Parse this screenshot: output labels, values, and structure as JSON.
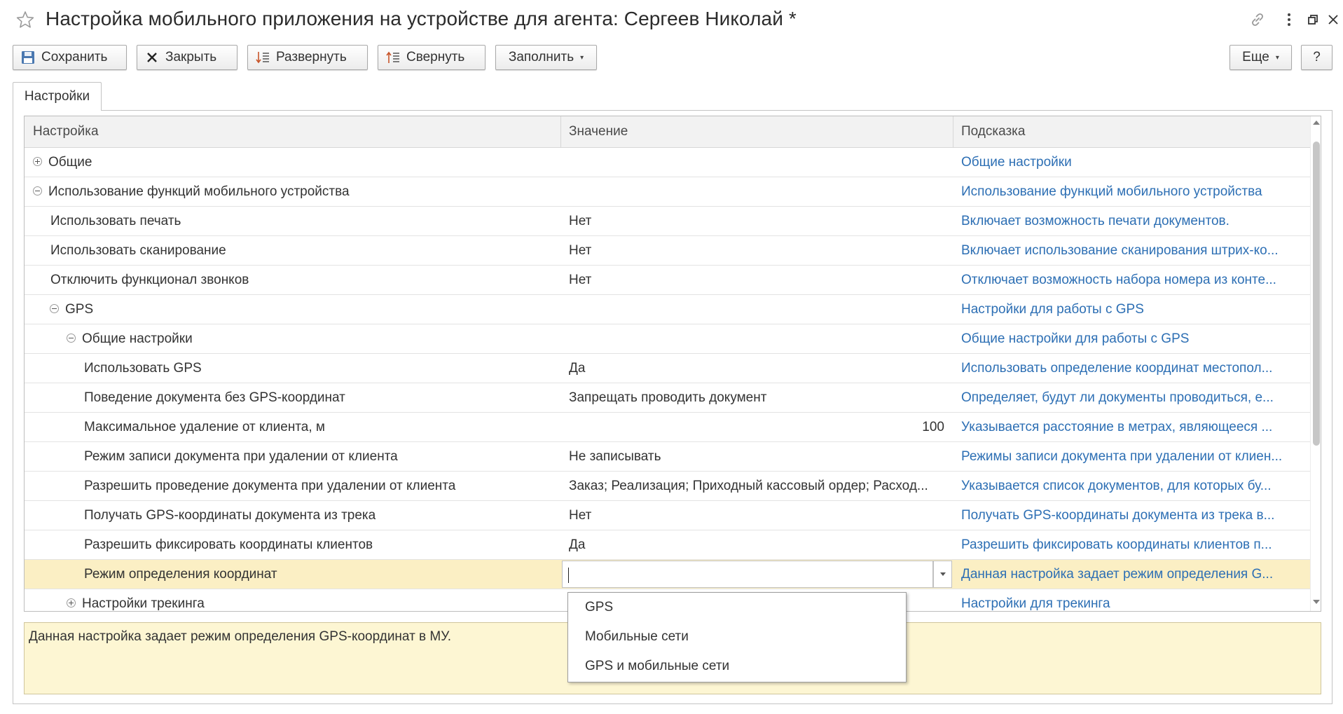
{
  "window": {
    "title": "Настройка мобильного приложения на устройстве для агента: Сергеев Николай *"
  },
  "toolbar": {
    "save": "Сохранить",
    "close": "Закрыть",
    "expand": "Развернуть",
    "collapse": "Свернуть",
    "fill": "Заполнить",
    "more": "Еще",
    "help": "?"
  },
  "tabs": {
    "settings": "Настройки"
  },
  "table": {
    "headers": {
      "setting": "Настройка",
      "value": "Значение",
      "hint": "Подсказка"
    },
    "rows": [
      {
        "name": "Общие",
        "value": "",
        "hint": "Общие настройки",
        "level": 0,
        "toggle": "plus"
      },
      {
        "name": "Использование функций мобильного устройства",
        "value": "",
        "hint": "Использование функций мобильного устройства",
        "level": 0,
        "toggle": "minus"
      },
      {
        "name": "Использовать печать",
        "value": "Нет",
        "hint": "Включает возможность печати документов.",
        "level": 1
      },
      {
        "name": "Использовать сканирование",
        "value": "Нет",
        "hint": "Включает использование сканирования штрих-ко...",
        "level": 1
      },
      {
        "name": "Отключить функционал звонков",
        "value": "Нет",
        "hint": "Отключает возможность набора номера из конте...",
        "level": 1
      },
      {
        "name": "GPS",
        "value": "",
        "hint": "Настройки для работы с GPS",
        "level": 1,
        "toggle": "minus"
      },
      {
        "name": "Общие настройки",
        "value": "",
        "hint": "Общие настройки для работы с GPS",
        "level": 2,
        "toggle": "minus"
      },
      {
        "name": "Использовать GPS",
        "value": "Да",
        "hint": "Использовать определение координат местопол...",
        "level": 3
      },
      {
        "name": "Поведение документа без GPS-координат",
        "value": "Запрещать проводить документ",
        "hint": "Определяет, будут ли документы проводиться, е...",
        "level": 3
      },
      {
        "name": "Максимальное удаление от клиента, м",
        "value": "100",
        "hint": "Указывается расстояние в метрах, являющееся ...",
        "level": 3,
        "numeric": true
      },
      {
        "name": "Режим записи документа при удалении от клиента",
        "value": "Не записывать",
        "hint": "Режимы записи документа при удалении от клиен...",
        "level": 3
      },
      {
        "name": "Разрешить проведение документа при удалении от клиента",
        "value": "Заказ; Реализация; Приходный кассовый ордер; Расход...",
        "hint": "Указывается список документов, для которых бу...",
        "level": 3
      },
      {
        "name": "Получать GPS-координаты документа из трека",
        "value": "Нет",
        "hint": "Получать GPS-координаты документа из трека в...",
        "level": 3
      },
      {
        "name": "Разрешить фиксировать координаты клиентов",
        "value": "Да",
        "hint": "Разрешить фиксировать координаты клиентов п...",
        "level": 3
      },
      {
        "name": "Режим определения координат",
        "value": "",
        "hint": "Данная настройка задает режим определения G...",
        "level": 3,
        "selected": true,
        "editing": true
      },
      {
        "name": "Настройки трекинга",
        "value": "",
        "hint": "Настройки для трекинга",
        "level": 2,
        "toggle": "plus"
      }
    ]
  },
  "hint_panel": {
    "text": "Данная настройка задает режим определения GPS-координат в МУ."
  },
  "dropdown": {
    "options": [
      "GPS",
      "Мобильные сети",
      "GPS и мобильные сети"
    ]
  },
  "colors": {
    "hint_link": "#2d6fb4",
    "selected_row": "#fbefc4",
    "hint_panel_bg": "#fdf6d3"
  }
}
